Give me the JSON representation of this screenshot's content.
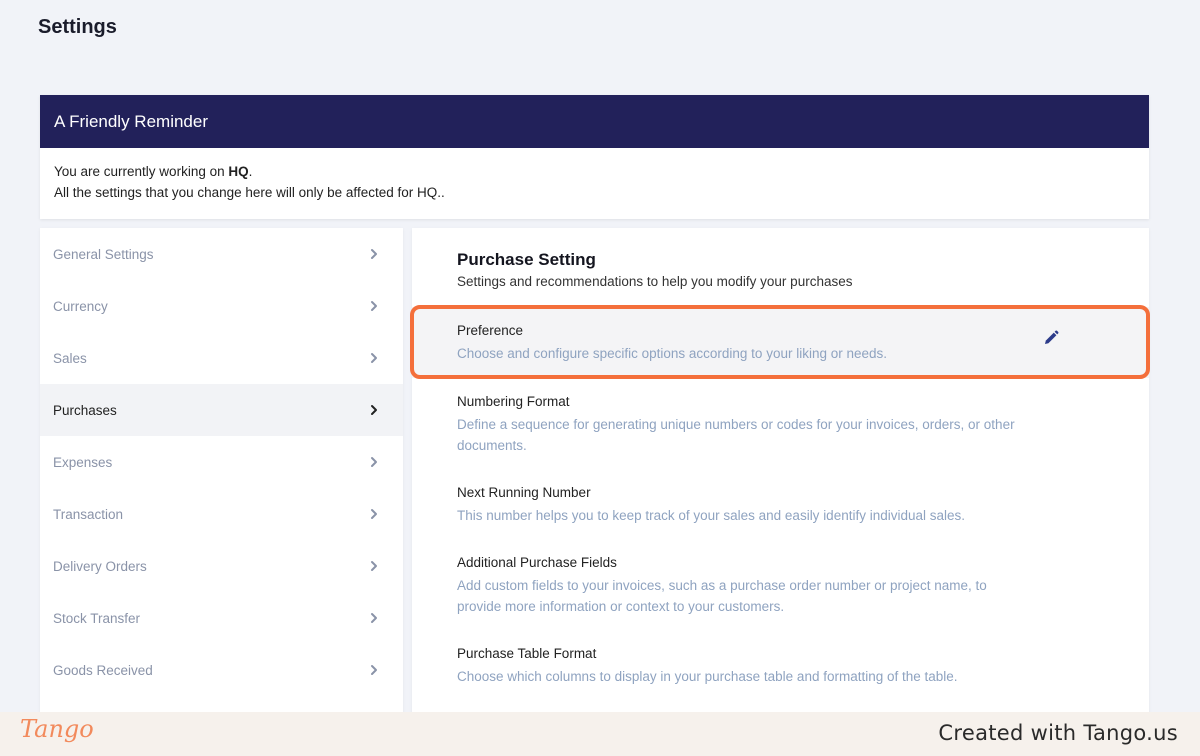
{
  "page": {
    "title": "Settings"
  },
  "reminder": {
    "title": "A Friendly Reminder",
    "line1_prefix": "You are currently working on ",
    "line1_branch": "HQ",
    "line1_suffix": ".",
    "line2": "All the settings that you change here will only be affected for HQ.."
  },
  "sidebar": {
    "items": [
      {
        "label": "General Settings",
        "active": false
      },
      {
        "label": "Currency",
        "active": false
      },
      {
        "label": "Sales",
        "active": false
      },
      {
        "label": "Purchases",
        "active": true
      },
      {
        "label": "Expenses",
        "active": false
      },
      {
        "label": "Transaction",
        "active": false
      },
      {
        "label": "Delivery Orders",
        "active": false
      },
      {
        "label": "Stock Transfer",
        "active": false
      },
      {
        "label": "Goods Received",
        "active": false
      }
    ],
    "chevron_icon": "chevron-right-icon"
  },
  "content": {
    "title": "Purchase Setting",
    "subtitle": "Settings and recommendations to help you modify your purchases",
    "settings": [
      {
        "name": "Preference",
        "desc": "Choose and configure specific options according to your liking or needs."
      },
      {
        "name": "Numbering Format",
        "desc": "Define a sequence for generating unique numbers or codes for your invoices, orders, or other documents."
      },
      {
        "name": "Next Running Number",
        "desc": "This number helps you to keep track of your sales and easily identify individual sales."
      },
      {
        "name": "Additional Purchase Fields",
        "desc": "Add custom fields to your invoices, such as a purchase order number or project name, to provide more information or context to your customers."
      },
      {
        "name": "Purchase Table Format",
        "desc": "Choose which columns to display in your purchase table and formatting of the table."
      }
    ],
    "edit_icon": "pencil-icon"
  },
  "footer": {
    "logo": "Tango",
    "credit": "Created with Tango.us"
  },
  "colors": {
    "header_bg": "#22215a",
    "highlight": "#f46f3b",
    "muted_text": "#8fa3c0",
    "active_item_bg": "#f2f3f6"
  }
}
